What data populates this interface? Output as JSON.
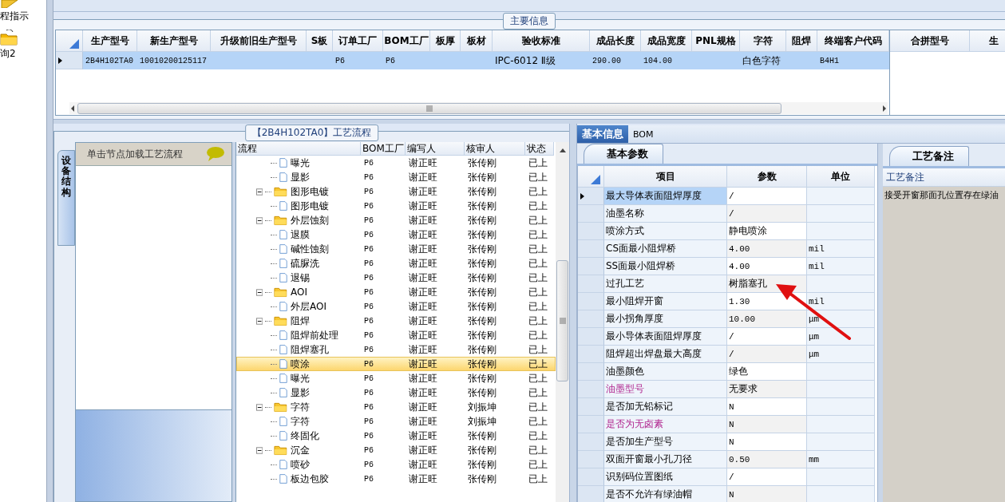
{
  "nav": [
    {
      "label": "程指示"
    },
    {
      "label": "询2"
    }
  ],
  "info_panel": {
    "title": "主要信息",
    "columns": [
      "生产型号",
      "新生产型号",
      "升级前旧生产型号",
      "S板",
      "订单工厂",
      "BOM工厂",
      "板厚",
      "板材",
      "验收标准",
      "成品长度",
      "成品宽度",
      "PNL规格",
      "字符",
      "阻焊",
      "终端客户代码"
    ],
    "rows": [
      {
        "selected": true,
        "cells": [
          "2B4H102TA0",
          "10010200125117",
          null,
          null,
          "P6",
          "P6",
          null,
          null,
          "IPC-6012 Ⅱ级",
          "290.00",
          "104.00",
          null,
          "白色字符",
          null,
          "B4H1"
        ]
      }
    ],
    "side_columns": [
      "合拼型号",
      "生"
    ]
  },
  "flow_panel": {
    "title": "【2B4H102TA0】工艺流程",
    "side_tab": "设备结构",
    "hint": "单击节点加载工艺流程",
    "columns": [
      "流程",
      "BOM工厂",
      "编写人",
      "核审人",
      "状态"
    ],
    "tree": [
      {
        "children": [
          {
            "label": "曝光",
            "bom": "P6",
            "writer": "谢正旺",
            "reviewer": "张传刚",
            "status": "已上",
            "selected": false
          },
          {
            "label": "显影",
            "bom": "P6",
            "writer": "谢正旺",
            "reviewer": "张传刚",
            "status": "已上",
            "selected": false
          }
        ]
      },
      {
        "label": "图形电镀",
        "bom": "P6",
        "writer": "谢正旺",
        "reviewer": "张传刚",
        "status": "已上",
        "selected": false,
        "expanded": true,
        "children": [
          {
            "label": "图形电镀",
            "bom": "P6",
            "writer": "谢正旺",
            "reviewer": "张传刚",
            "status": "已上",
            "selected": false
          }
        ]
      },
      {
        "label": "外层蚀刻",
        "bom": "P6",
        "writer": "谢正旺",
        "reviewer": "张传刚",
        "status": "已上",
        "selected": false,
        "expanded": true,
        "children": [
          {
            "label": "退膜",
            "bom": "P6",
            "writer": "谢正旺",
            "reviewer": "张传刚",
            "status": "已上",
            "selected": false
          },
          {
            "label": "碱性蚀刻",
            "bom": "P6",
            "writer": "谢正旺",
            "reviewer": "张传刚",
            "status": "已上",
            "selected": false
          },
          {
            "label": "硫脲洗",
            "bom": "P6",
            "writer": "谢正旺",
            "reviewer": "张传刚",
            "status": "已上",
            "selected": false
          },
          {
            "label": "退锡",
            "bom": "P6",
            "writer": "谢正旺",
            "reviewer": "张传刚",
            "status": "已上",
            "selected": false
          }
        ]
      },
      {
        "label": "AOI",
        "bom": "P6",
        "writer": "谢正旺",
        "reviewer": "张传刚",
        "status": "已上",
        "selected": false,
        "expanded": true,
        "children": [
          {
            "label": "外层AOI",
            "bom": "P6",
            "writer": "谢正旺",
            "reviewer": "张传刚",
            "status": "已上",
            "selected": false
          }
        ]
      },
      {
        "label": "阻焊",
        "bom": "P6",
        "writer": "谢正旺",
        "reviewer": "张传刚",
        "status": "已上",
        "selected": false,
        "expanded": true,
        "children": [
          {
            "label": "阻焊前处理",
            "bom": "P6",
            "writer": "谢正旺",
            "reviewer": "张传刚",
            "status": "已上",
            "selected": false
          },
          {
            "label": "阻焊塞孔",
            "bom": "P6",
            "writer": "谢正旺",
            "reviewer": "张传刚",
            "status": "已上",
            "selected": false
          },
          {
            "label": "喷涂",
            "bom": "P6",
            "writer": "谢正旺",
            "reviewer": "张传刚",
            "status": "已上",
            "selected": true
          },
          {
            "label": "曝光",
            "bom": "P6",
            "writer": "谢正旺",
            "reviewer": "张传刚",
            "status": "已上",
            "selected": false
          },
          {
            "label": "显影",
            "bom": "P6",
            "writer": "谢正旺",
            "reviewer": "张传刚",
            "status": "已上",
            "selected": false
          }
        ]
      },
      {
        "label": "字符",
        "bom": "P6",
        "writer": "谢正旺",
        "reviewer": "刘振坤",
        "status": "已上",
        "selected": false,
        "expanded": true,
        "children": [
          {
            "label": "字符",
            "bom": "P6",
            "writer": "谢正旺",
            "reviewer": "刘振坤",
            "status": "已上",
            "selected": false
          },
          {
            "label": "终固化",
            "bom": "P6",
            "writer": "谢正旺",
            "reviewer": "张传刚",
            "status": "已上",
            "selected": false
          }
        ]
      },
      {
        "label": "沉金",
        "bom": "P6",
        "writer": "谢正旺",
        "reviewer": "张传刚",
        "status": "已上",
        "selected": false,
        "expanded": true,
        "children": [
          {
            "label": "喷砂",
            "bom": "P6",
            "writer": "谢正旺",
            "reviewer": "张传刚",
            "status": "已上",
            "selected": false
          },
          {
            "label": "板边包胶",
            "bom": "P6",
            "writer": "谢正旺",
            "reviewer": "张传刚",
            "status": "已上",
            "selected": false
          }
        ]
      }
    ]
  },
  "detail_tabs": [
    {
      "label": "基本信息",
      "selected": true
    },
    {
      "label": "BOM",
      "selected": false
    }
  ],
  "params": {
    "tab": "基本参数",
    "columns": [
      "项目",
      "参数",
      "单位"
    ],
    "rows": [
      {
        "item": "最大导体表面阻焊厚度",
        "value": "/",
        "selected": true,
        "flagged": false
      },
      {
        "item": "油墨名称",
        "value": "/",
        "selected": false,
        "flagged": false
      },
      {
        "item": "喷涂方式",
        "value": "静电喷涂",
        "selected": false,
        "flagged": false
      },
      {
        "item": "CS面最小阻焊桥",
        "value": "4.00",
        "unit": "mil",
        "selected": false,
        "flagged": false
      },
      {
        "item": "SS面最小阻焊桥",
        "value": "4.00",
        "unit": "mil",
        "selected": false,
        "flagged": false
      },
      {
        "item": "过孔工艺",
        "value": "树脂塞孔",
        "selected": false,
        "flagged": false
      },
      {
        "item": "最小阻焊开窗",
        "value": "1.30",
        "unit": "mil",
        "selected": false,
        "flagged": false
      },
      {
        "item": "最小拐角厚度",
        "value": "10.00",
        "unit": "μm",
        "selected": false,
        "flagged": false
      },
      {
        "item": "最小导体表面阻焊厚度",
        "value": "/",
        "unit": "μm",
        "selected": false,
        "flagged": false
      },
      {
        "item": "阻焊超出焊盘最大高度",
        "value": "/",
        "unit": "μm",
        "selected": false,
        "flagged": false
      },
      {
        "item": "油墨颜色",
        "value": "绿色",
        "selected": false,
        "flagged": false
      },
      {
        "item": "油墨型号",
        "value": "无要求",
        "selected": false,
        "flagged": true
      },
      {
        "item": "是否加无铅标记",
        "value": "N",
        "selected": false,
        "flagged": false
      },
      {
        "item": "是否为无卤素",
        "value": "N",
        "selected": false,
        "flagged": true
      },
      {
        "item": "是否加生产型号",
        "value": "N",
        "selected": false,
        "flagged": false
      },
      {
        "item": "双面开窗最小孔刀径",
        "value": "0.50",
        "unit": "mm",
        "selected": false,
        "flagged": false
      },
      {
        "item": "识别码位置图纸",
        "value": "/",
        "selected": false,
        "flagged": false
      },
      {
        "item": "是否不允许有绿油帽",
        "value": "N",
        "selected": false,
        "flagged": false
      }
    ]
  },
  "notes": {
    "tab": "工艺备注",
    "label": "工艺备注",
    "text": "接受开窗那面孔位置存在绿油"
  }
}
